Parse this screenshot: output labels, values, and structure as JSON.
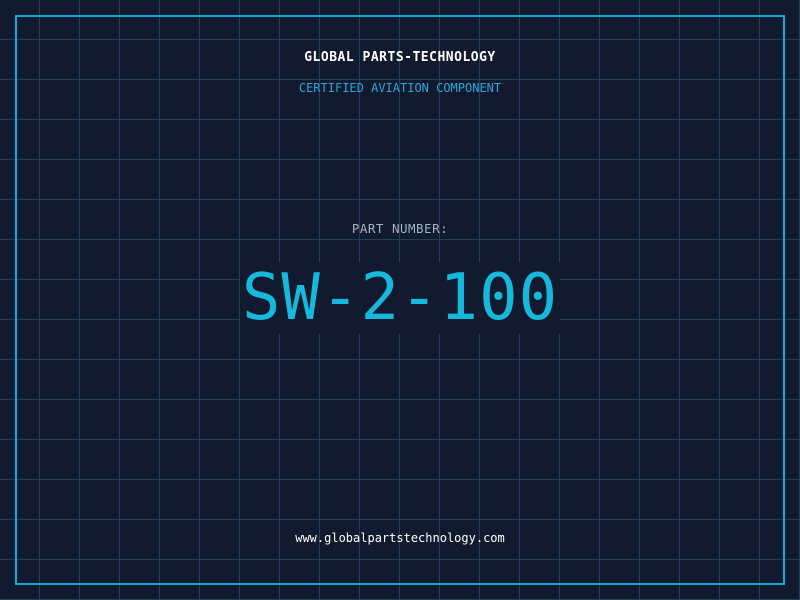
{
  "header": {
    "company": "GLOBAL PARTS-TECHNOLOGY",
    "subtitle": "CERTIFIED AVIATION COMPONENT"
  },
  "part": {
    "label": "PART NUMBER:",
    "number": "SW-2-100"
  },
  "footer": {
    "website": "www.globalpartstechnology.com"
  },
  "colors": {
    "background": "#111a2e",
    "grid": "#1d4257",
    "accent": "#13a9d6",
    "part_number": "#16b8dc"
  }
}
